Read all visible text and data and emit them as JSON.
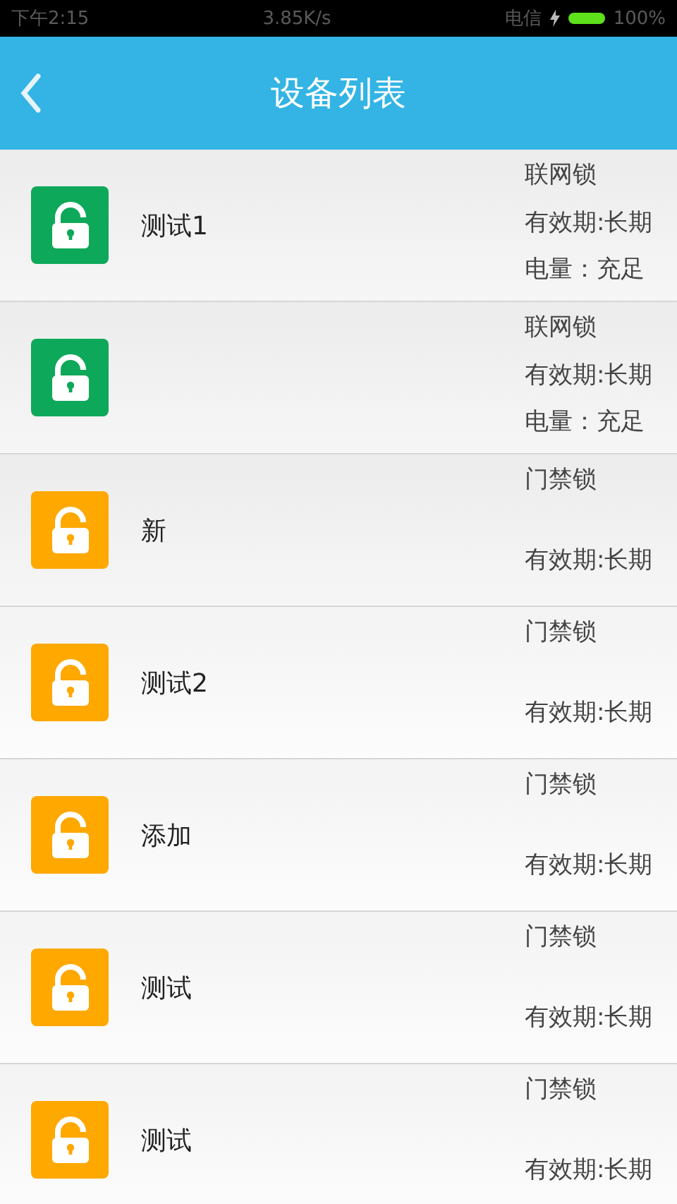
{
  "status_bar": {
    "time": "下午2:15",
    "speed": "3.85K/s",
    "carrier": "电信",
    "battery": "100%"
  },
  "header": {
    "title": "设备列表"
  },
  "devices": [
    {
      "name": "测试1",
      "color": "#0ea85a",
      "type": "联网锁",
      "validity": "有效期:长期",
      "power": "电量：充足"
    },
    {
      "color": "#0ea85a",
      "type": "联网锁",
      "validity": "有效期:长期",
      "power": "电量：充足"
    },
    {
      "name": "新",
      "color": "#fea800",
      "type": "门禁锁",
      "validity": "有效期:长期"
    },
    {
      "name": "测试2",
      "color": "#fea800",
      "type": "门禁锁",
      "validity": "有效期:长期"
    },
    {
      "name": "添加",
      "color": "#fea800",
      "type": "门禁锁",
      "validity": "有效期:长期"
    },
    {
      "name": "测试",
      "color": "#fea800",
      "type": "门禁锁",
      "validity": "有效期:长期"
    },
    {
      "name": "测试",
      "color": "#fea800",
      "type": "门禁锁",
      "validity": "有效期:长期"
    }
  ]
}
